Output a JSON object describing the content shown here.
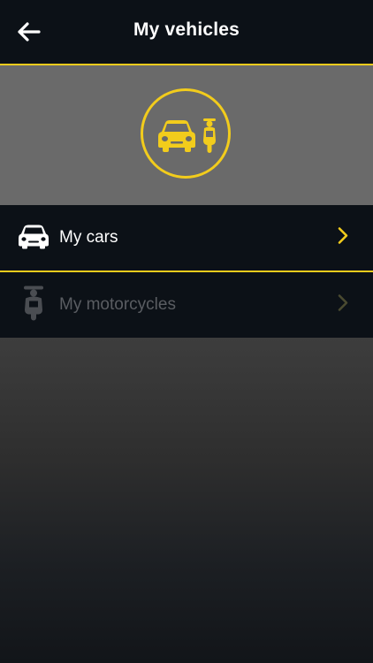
{
  "header": {
    "title": "My vehicles",
    "back_icon": "arrow-left-icon"
  },
  "hero": {
    "icon": "car-and-motorcycle-icon"
  },
  "menu": {
    "items": [
      {
        "label": "My cars",
        "icon": "car-icon",
        "chevron": "chevron-right-icon",
        "enabled": true
      },
      {
        "label": "My motorcycles",
        "icon": "motorcycle-icon",
        "chevron": "chevron-right-icon",
        "enabled": false
      }
    ]
  },
  "colors": {
    "accent": "#f2cc1c",
    "header_bg": "#0c1117",
    "hero_bg": "#6a6a6a",
    "disabled_text": "#5a5d62"
  }
}
